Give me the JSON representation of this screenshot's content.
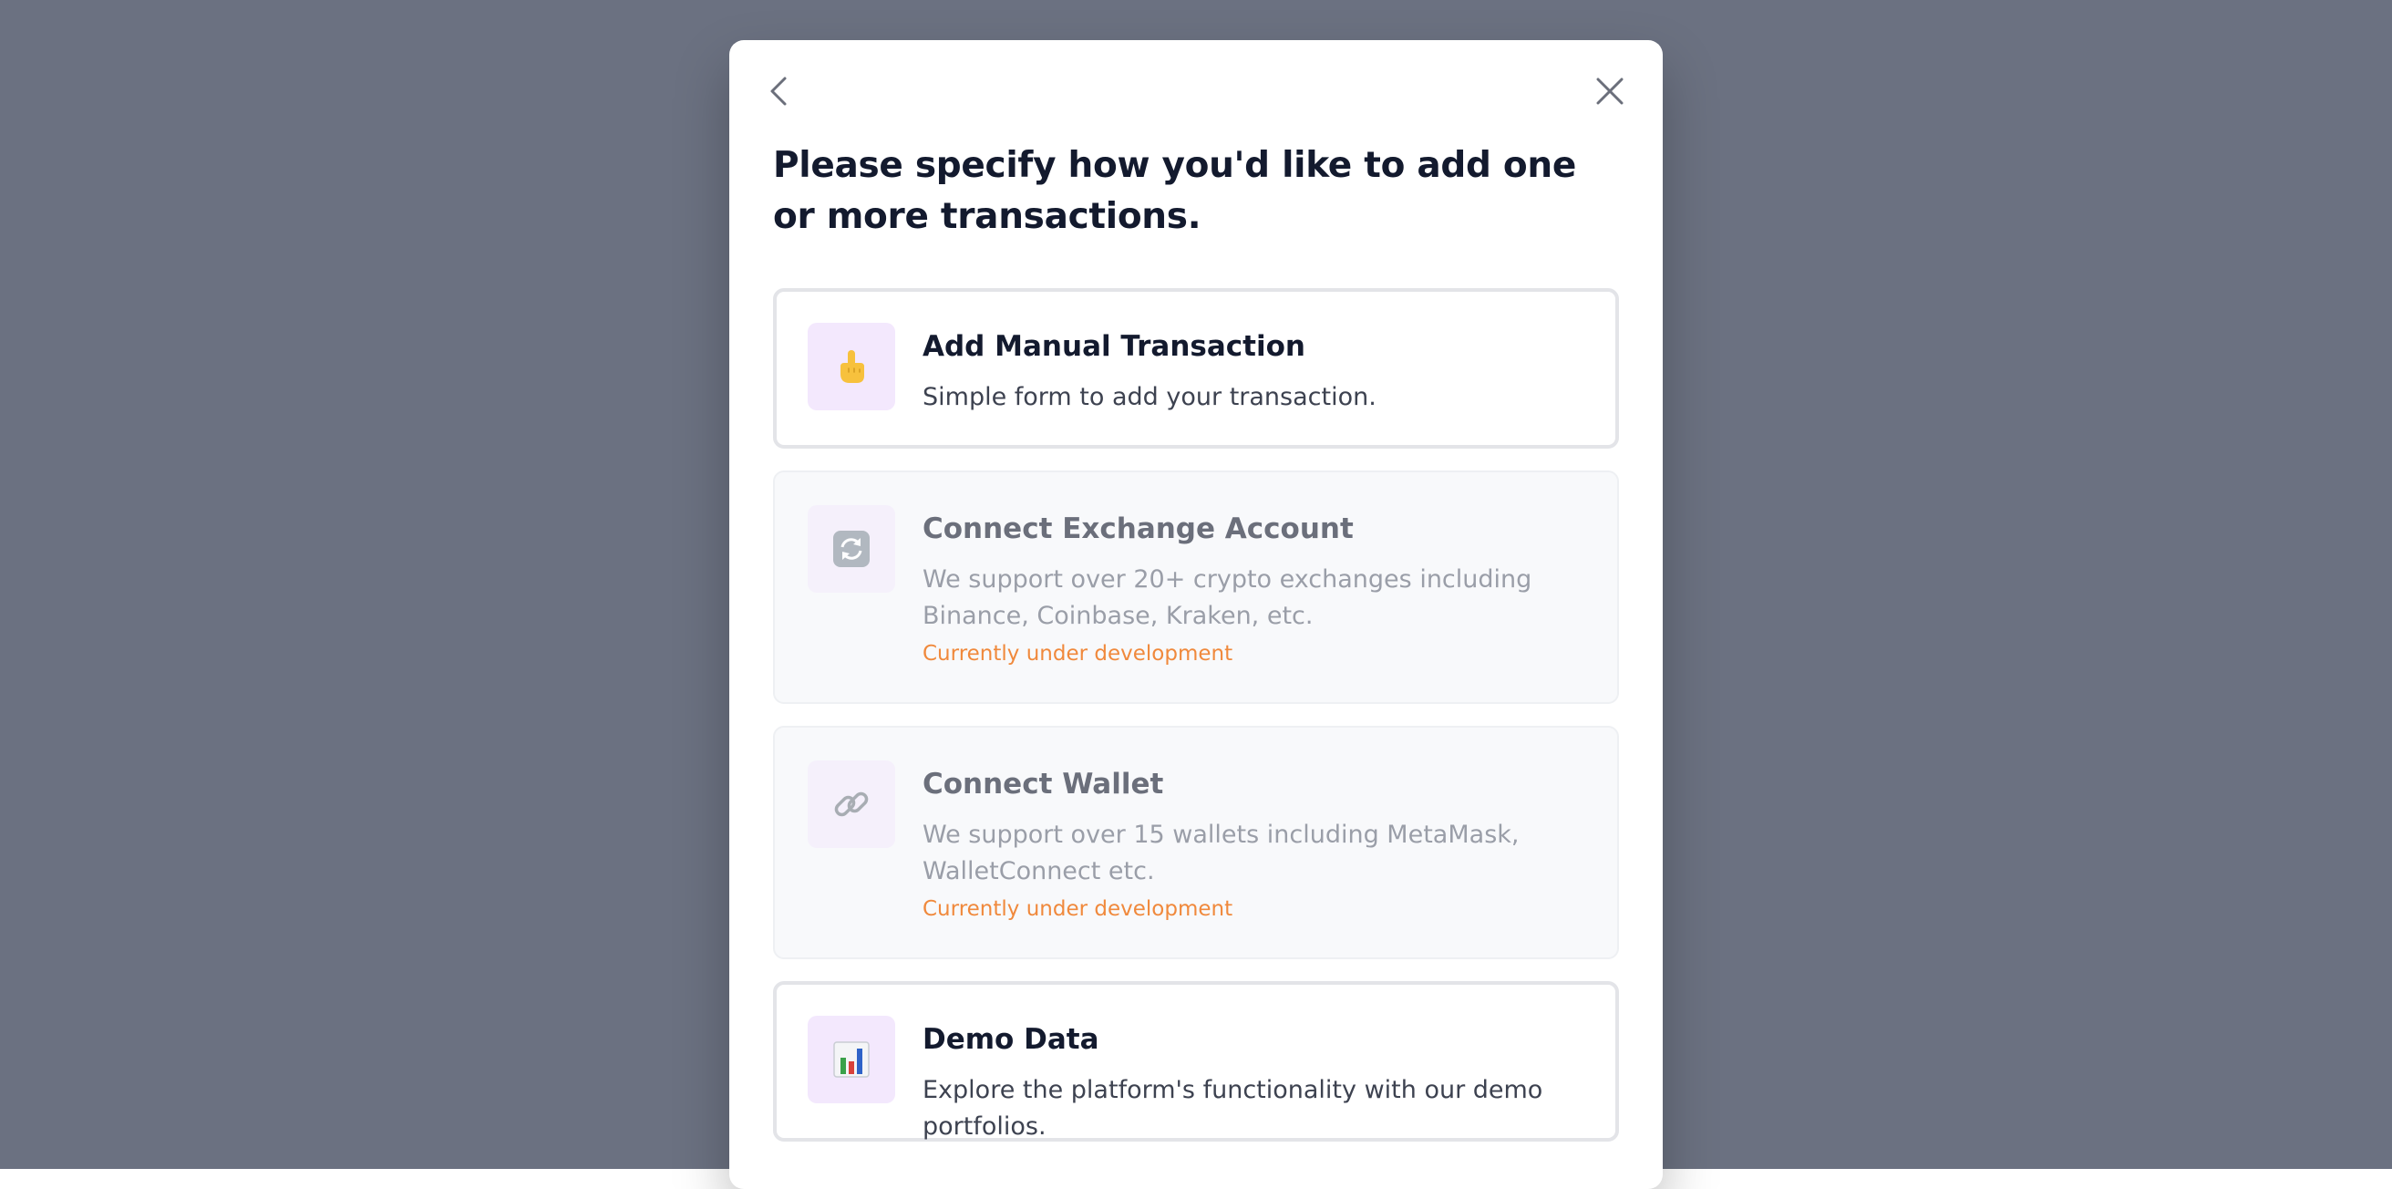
{
  "modal": {
    "title": "Please specify how you'd like to add one or more transactions.",
    "back_icon": "chevron-left-icon",
    "close_icon": "close-icon"
  },
  "options": [
    {
      "title": "Add Manual Transaction",
      "description": "Simple form to add your transaction.",
      "icon": "pointing-hand-icon",
      "enabled": true
    },
    {
      "title": "Connect Exchange Account",
      "description": "We support over 20+ crypto exchanges including Binance, Coinbase, Kraken, etc.",
      "badge": "Currently under development",
      "icon": "sync-arrows-icon",
      "enabled": false
    },
    {
      "title": "Connect Wallet",
      "description": "We support over 15 wallets including MetaMask, WalletConnect etc.",
      "badge": "Currently under development",
      "icon": "link-icon",
      "enabled": false
    },
    {
      "title": "Demo Data",
      "description": "Explore the platform's functionality with our demo portfolios.",
      "icon": "bar-chart-icon",
      "enabled": true
    }
  ],
  "colors": {
    "backdrop": "#6b7181",
    "icon_tile": "#f3e8fd",
    "badge": "#f0893c",
    "title": "#131a2e"
  }
}
